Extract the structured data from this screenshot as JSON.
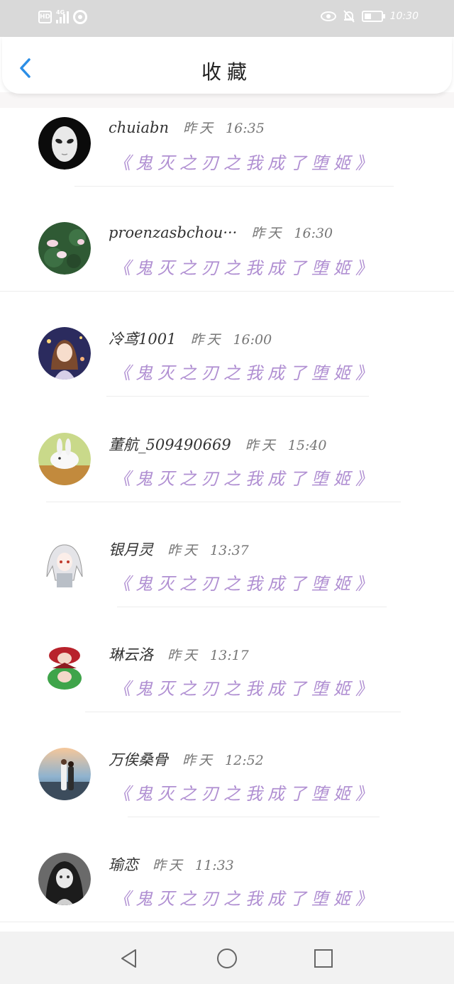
{
  "status_bar": {
    "network_tag": "4G",
    "hd_label": "HD",
    "time": "10:30"
  },
  "header": {
    "title": "收藏"
  },
  "favorites": [
    {
      "name": "chuiabn",
      "day": "昨天",
      "time": "16:35",
      "book": "《鬼灭之刃之我成了堕姬》",
      "avatar": "white-mask"
    },
    {
      "name": "proenzasbchou···",
      "day": "昨天",
      "time": "16:30",
      "book": "《鬼灭之刃之我成了堕姬》",
      "avatar": "lotus-pond"
    },
    {
      "name": "冷鸢1001",
      "day": "昨天",
      "time": "16:00",
      "book": "《鬼灭之刃之我成了堕姬》",
      "avatar": "anime-girl-night"
    },
    {
      "name": "董航_509490669",
      "day": "昨天",
      "time": "15:40",
      "book": "《鬼灭之刃之我成了堕姬》",
      "avatar": "white-rabbit"
    },
    {
      "name": "银月灵",
      "day": "昨天",
      "time": "13:37",
      "book": "《鬼灭之刃之我成了堕姬》",
      "avatar": "white-hair-girl"
    },
    {
      "name": "琳云洛",
      "day": "昨天",
      "time": "13:17",
      "book": "《鬼灭之刃之我成了堕姬》",
      "avatar": "red-green-characters"
    },
    {
      "name": "万俟桑骨",
      "day": "昨天",
      "time": "12:52",
      "book": "《鬼灭之刃之我成了堕姬》",
      "avatar": "couple-sunset"
    },
    {
      "name": "瑜恋",
      "day": "昨天",
      "time": "11:33",
      "book": "《鬼灭之刃之我成了堕姬》",
      "avatar": "dark-hair-girl"
    }
  ],
  "colors": {
    "accent_blue": "#2b8ee6",
    "book_purple": "#b08fd2",
    "status_bar_bg": "#d9d9d9",
    "nav_bar_bg": "#f2f2f2"
  },
  "icons": [
    "back-icon",
    "eye-icon",
    "bell-off-icon",
    "battery-icon",
    "nav-back-icon",
    "nav-home-icon",
    "nav-recent-icon"
  ]
}
